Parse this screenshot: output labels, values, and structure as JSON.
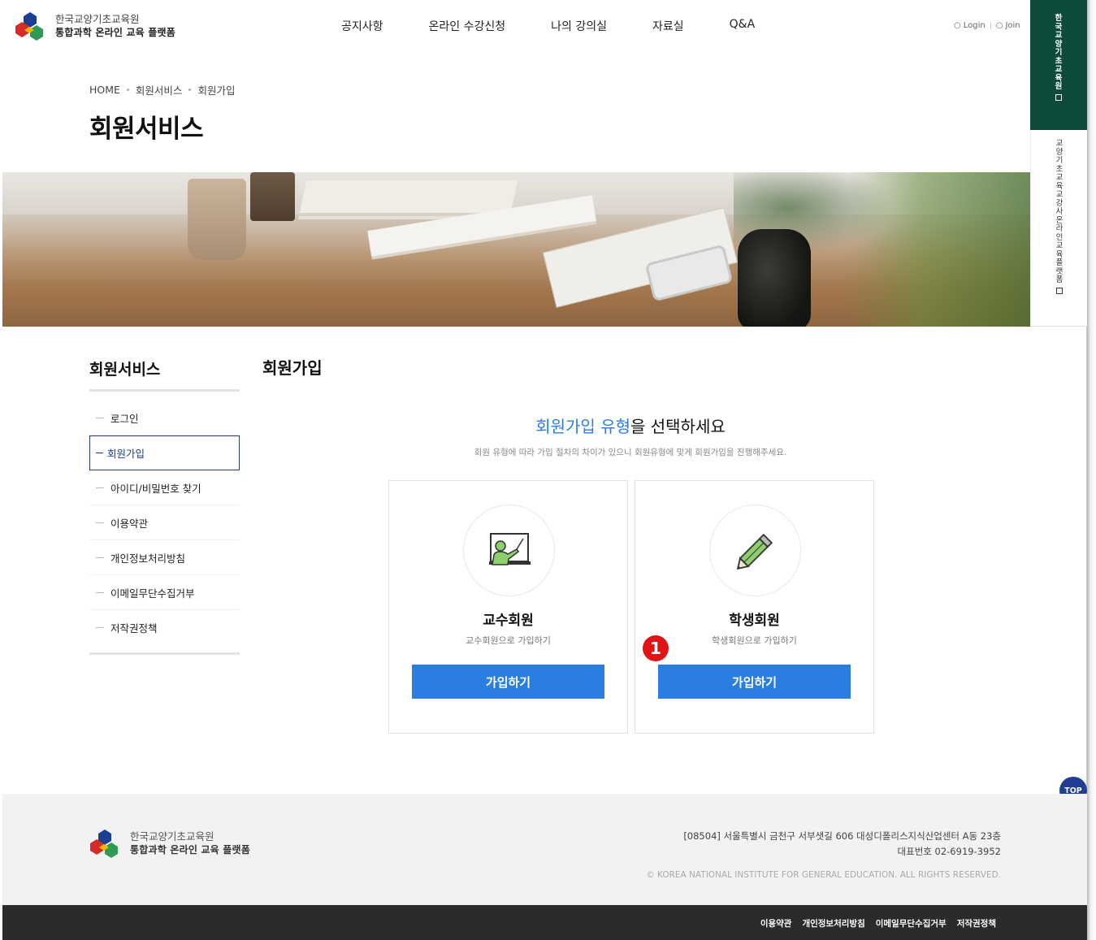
{
  "header": {
    "logo_line1": "한국교양기초교육원",
    "logo_line2": "통합과학 온라인 교육 플랫폼",
    "nav": [
      "공지사항",
      "온라인 수강신청",
      "나의 강의실",
      "자료실",
      "Q&A"
    ],
    "login": "Login",
    "join": "Join"
  },
  "quick": {
    "item1": "한국교양기초교육원",
    "item2": "교양기초교육교강사온라인교육플랫폼"
  },
  "page": {
    "breadcrumb": [
      "HOME",
      "회원서비스",
      "회원가입"
    ],
    "title": "회원서비스"
  },
  "lnb": {
    "title": "회원서비스",
    "items": [
      "로그인",
      "회원가입",
      "아이디/비밀번호 찾기",
      "이용약관",
      "개인정보처리방침",
      "이메일무단수집거부",
      "저작권정책"
    ],
    "active_index": 1
  },
  "content": {
    "title": "회원가입",
    "heading_highlight": "회원가입 유형",
    "heading_rest": "을 선택하세요",
    "subtext": "회원 유형에 따라 가입 절차의 차이가 있으니 회원유형에 맞게 회원가입을 진행해주세요.",
    "cards": [
      {
        "title": "교수회원",
        "desc": "교수회원으로 가입하기",
        "button": "가입하기",
        "icon": "teacher-board-icon"
      },
      {
        "title": "학생회원",
        "desc": "학생회원으로 가입하기",
        "button": "가입하기",
        "icon": "pencil-icon"
      }
    ],
    "step_badge": "1"
  },
  "footer": {
    "logo_line1": "한국교양기초교육원",
    "logo_line2": "통합과학 온라인 교육 플랫폼",
    "address": "[08504] 서울특별시 금천구 서부샛길 606 대성디폴리스지식산업센터 A동 23층",
    "phone": "대표번호 02-6919-3952",
    "copyright": "© KOREA NATIONAL INSTITUTE FOR GENERAL EDUCATION. ALL RIGHTS RESERVED.",
    "links": [
      "이용약관",
      "개인정보처리방침",
      "이메일무단수집거부",
      "저작권정책"
    ]
  },
  "top_button": "TOP",
  "colors": {
    "accent_blue": "#2b7de0",
    "brand_green": "#0d4a3a",
    "top_button": "#1f3d92",
    "badge_red": "#e01414"
  }
}
